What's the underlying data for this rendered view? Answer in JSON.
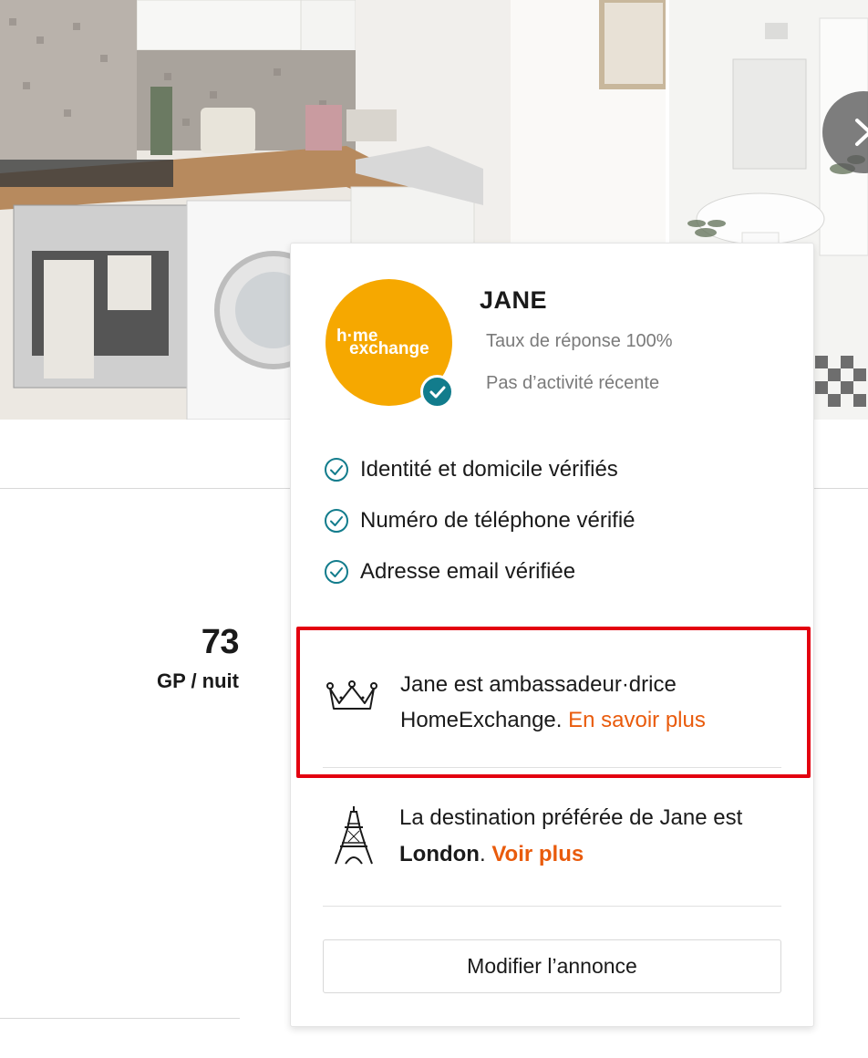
{
  "gallery": {
    "photos": [
      "kitchen",
      "bathroom"
    ],
    "next_icon": "chevron-right-icon"
  },
  "listing": {
    "price_value": "73",
    "price_unit": "GP / nuit"
  },
  "host": {
    "name": "JANE",
    "logo_line1": "h·me",
    "logo_line2": "exchange",
    "response_rate": "Taux de réponse 100%",
    "activity": "Pas d’activité récente",
    "verified_icon": "check-badge-icon",
    "verifications": [
      "Identité et domicile vérifiés",
      "Numéro de téléphone vérifié",
      "Adresse email vérifiée"
    ],
    "ambassador_text": "Jane est ambassadeur·drice HomeExchange.",
    "ambassador_link": "En savoir plus",
    "destination_prefix": "La destination préférée de Jane est",
    "destination_city": "London",
    "destination_link": "Voir plus",
    "edit_button": "Modifier l’annonce"
  },
  "colors": {
    "brand_orange": "#f6a800",
    "link_orange": "#e95b0c",
    "verified_teal": "#127c8c",
    "highlight_red": "#e3000f"
  }
}
